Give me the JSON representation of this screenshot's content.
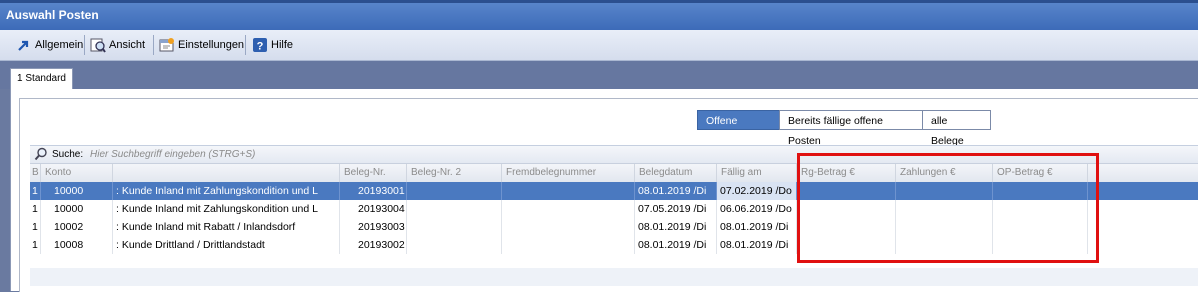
{
  "window": {
    "title": "Auswahl Posten"
  },
  "toolbar": {
    "allgemein": "Allgemein",
    "ansicht": "Ansicht",
    "einstellungen": "Einstellungen",
    "hilfe": "Hilfe"
  },
  "tabs": [
    {
      "label": "1 Standard"
    }
  ],
  "filters": {
    "offene": "Offene Posten",
    "faellige": "Bereits fällige offene Posten",
    "alle": "alle Belege",
    "selected": "Offene Posten"
  },
  "search": {
    "label": "Suche:",
    "placeholder": "Hier Suchbegriff eingeben (STRG+S)"
  },
  "table": {
    "columns": [
      "B",
      "Konto",
      "",
      "Beleg-Nr.",
      "Beleg-Nr. 2",
      "Fremdbelegnummer",
      "Belegdatum",
      "Fällig am",
      "Rg-Betrag €",
      "Zahlungen €",
      "OP-Betrag €"
    ],
    "rows": [
      {
        "b": "1",
        "konto": "10000",
        "name": ": Kunde Inland mit Zahlungskondition und L",
        "beleg": "20193001",
        "beleg2": "",
        "fremd": "",
        "datum": "08.01.2019 /Di",
        "faellig": "07.02.2019 /Do",
        "rg": "",
        "zahl": "",
        "op": ""
      },
      {
        "b": "1",
        "konto": "10000",
        "name": ": Kunde Inland mit Zahlungskondition und L",
        "beleg": "20193004",
        "beleg2": "",
        "fremd": "",
        "datum": "07.05.2019 /Di",
        "faellig": "06.06.2019 /Do",
        "rg": "",
        "zahl": "",
        "op": ""
      },
      {
        "b": "1",
        "konto": "10002",
        "name": ": Kunde Inland mit Rabatt / Inlandsdorf",
        "beleg": "20193003",
        "beleg2": "",
        "fremd": "",
        "datum": "08.01.2019 /Di",
        "faellig": "08.01.2019 /Di",
        "rg": "",
        "zahl": "",
        "op": ""
      },
      {
        "b": "1",
        "konto": "10008",
        "name": ": Kunde Drittland / Drittlandstadt",
        "beleg": "20193002",
        "beleg2": "",
        "fremd": "",
        "datum": "08.01.2019 /Di",
        "faellig": "08.01.2019 /Di",
        "rg": "",
        "zahl": "",
        "op": ""
      }
    ],
    "selected_row": 0
  },
  "colors": {
    "accent": "#4a79c0",
    "highlight_box": "#e01010"
  }
}
